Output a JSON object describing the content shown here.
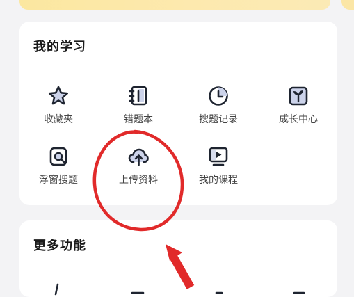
{
  "colors": {
    "banner": "#fde9ae",
    "card": "#ffffff",
    "background": "#f3f3f5",
    "icon_stroke": "#1e2430",
    "icon_fill": "#ccd3ea",
    "annotation": "#e12a2a"
  },
  "my_learning": {
    "title": "我的学习",
    "items": [
      {
        "label": "收藏夹",
        "icon": "star-icon"
      },
      {
        "label": "错题本",
        "icon": "notebook-icon"
      },
      {
        "label": "搜题记录",
        "icon": "clock-icon"
      },
      {
        "label": "成长中心",
        "icon": "sprout-icon"
      },
      {
        "label": "浮窗搜题",
        "icon": "float-search-icon"
      },
      {
        "label": "上传资料",
        "icon": "cloud-upload-icon"
      },
      {
        "label": "我的课程",
        "icon": "video-course-icon"
      }
    ]
  },
  "more_features": {
    "title": "更多功能"
  }
}
